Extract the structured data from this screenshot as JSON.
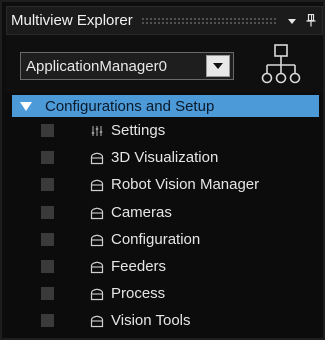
{
  "window": {
    "title": "Multiview Explorer",
    "dropdown_label": "▼",
    "pin_label": "Ꮁ"
  },
  "toolbar": {
    "app_selector_value": "ApplicationManager0",
    "hierarchy_icon": "hierarchy-icon"
  },
  "tree": {
    "root": {
      "label": "Configurations and Setup",
      "expanded": true
    },
    "items": [
      {
        "label": "Settings",
        "icon": "settings-sliders-icon"
      },
      {
        "label": "3D Visualization",
        "icon": "folder-icon"
      },
      {
        "label": "Robot Vision Manager",
        "icon": "folder-icon"
      },
      {
        "label": "Cameras",
        "icon": "folder-icon"
      },
      {
        "label": "Configuration",
        "icon": "folder-icon"
      },
      {
        "label": "Feeders",
        "icon": "folder-icon"
      },
      {
        "label": "Process",
        "icon": "folder-icon"
      },
      {
        "label": "Vision Tools",
        "icon": "folder-icon"
      }
    ]
  },
  "colors": {
    "selection": "#4d9ad8",
    "background": "#0d0d0d",
    "text": "#e6e6e6"
  }
}
